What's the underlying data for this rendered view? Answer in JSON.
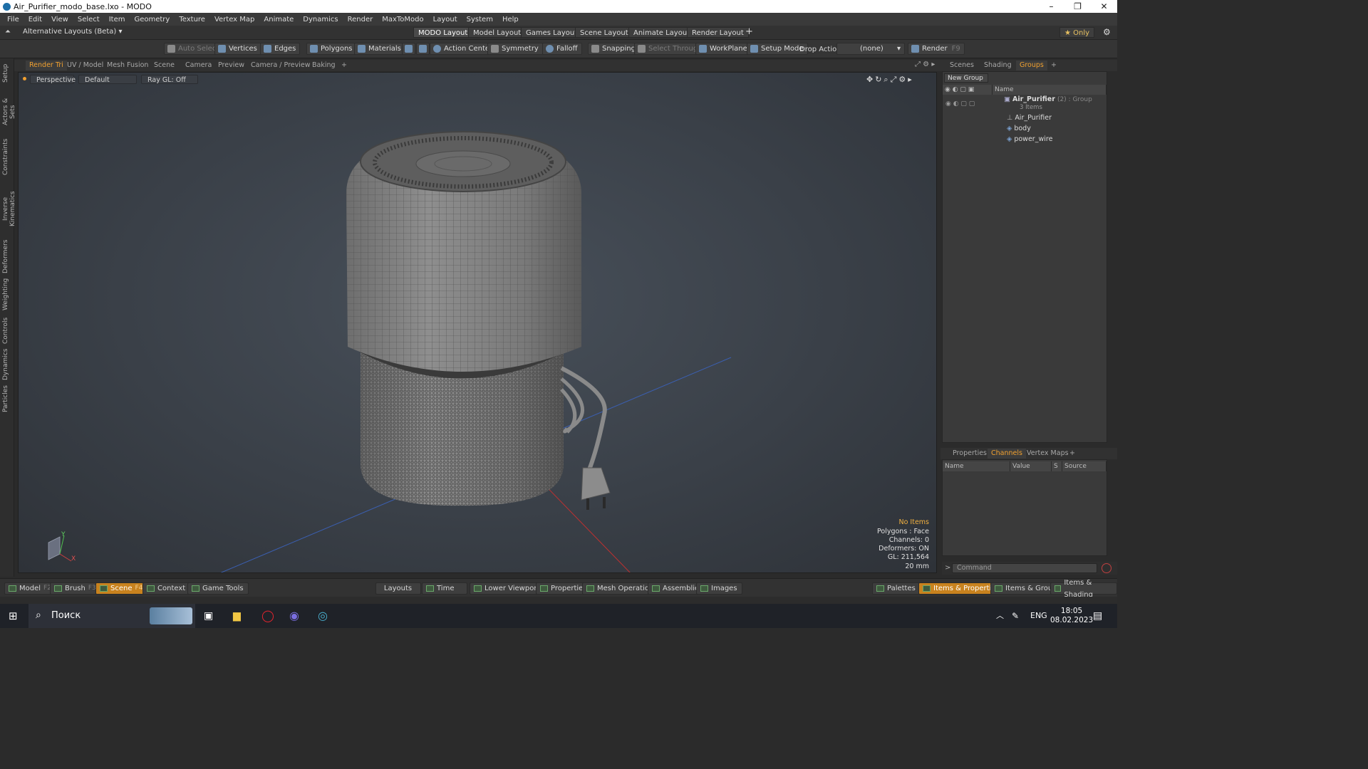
{
  "window": {
    "title": "Air_Purifier_modo_base.lxo - MODO",
    "controls": [
      "–",
      "❐",
      "✕"
    ]
  },
  "menu": [
    "File",
    "Edit",
    "View",
    "Select",
    "Item",
    "Geometry",
    "Texture",
    "Vertex Map",
    "Animate",
    "Dynamics",
    "Render",
    "MaxToModo",
    "Layout",
    "System",
    "Help"
  ],
  "layoutbar": {
    "alt_layouts": "Alternative Layouts (Beta) ▾",
    "tabs": [
      "MODO Layout",
      "Model Layout",
      "Games Layout",
      "Scene Layout",
      "Animate Layout",
      "Render Layout"
    ],
    "add": "+",
    "only": "★  Only"
  },
  "toolbar": {
    "auto_select": "Auto Select",
    "vertices": "Vertices",
    "edges": "Edges",
    "polygons": "Polygons",
    "materials": "Materials",
    "action_center": "Action Center",
    "symmetry": "Symmetry",
    "falloff": "Falloff",
    "snapping": "Snapping",
    "select_through": "Select Through",
    "workplane": "WorkPlane",
    "setup_mode": "Setup Mode",
    "drop_action": "Drop Action",
    "drop_value": "(none)",
    "render": "Render",
    "render_key": "F9"
  },
  "left_tabs": [
    "Setup",
    "Actors & Sets",
    "Constraints",
    "Inverse Kinematics",
    "Deformers",
    "Weighting",
    "Controls",
    "Dynamics",
    "Particles"
  ],
  "viewport_tabs": [
    "Render Tri",
    "UV / Model",
    "Mesh Fusion",
    "Scene",
    "Camera",
    "Preview",
    "Camera / Preview",
    "Baking",
    "+"
  ],
  "viewport": {
    "view": "Perspective",
    "shading": "Default",
    "raygl": "Ray GL: Off",
    "info": {
      "items": "No Items",
      "polygons": "Polygons : Face",
      "channels": "Channels: 0",
      "deformers": "Deformers: ON",
      "gl": "GL: 211,564",
      "scale": "20 mm"
    },
    "axis_y": "Y",
    "axis_x": "X"
  },
  "right_top_tabs": [
    "Scenes",
    "Shading",
    "Groups",
    "+"
  ],
  "groups": {
    "new_group": "New Group",
    "col_name": "Name",
    "root": "Air_Purifier",
    "root_suffix": "(2) : Group",
    "root_count": "3 Items",
    "children": [
      "Air_Purifier",
      "body",
      "power_wire"
    ]
  },
  "right_bottom_tabs": [
    "Properties",
    "Channels",
    "Vertex Maps",
    "+"
  ],
  "channels": {
    "col_name": "Name",
    "col_value": "Value",
    "col_s": "S",
    "col_source": "Source"
  },
  "command": {
    "prompt": ">",
    "placeholder": "Command"
  },
  "bottom": {
    "model": "Model",
    "model_key": "F2",
    "brush": "Brush",
    "brush_key": "F3",
    "scene": "Scene",
    "scene_key": "F4",
    "context": "Context",
    "game_tools": "Game Tools",
    "layouts": "Layouts",
    "time": "Time",
    "lower_viewports": "Lower Viewports",
    "properties": "Properties",
    "mesh_operations": "Mesh Operations",
    "assemblies": "Assemblies",
    "images": "Images",
    "palettes": "Palettes",
    "items_properties": "Items & Properties",
    "items_groups": "Items & Groups",
    "items_shading": "Items & Shading"
  },
  "taskbar": {
    "search": "Поиск",
    "lang": "ENG",
    "time": "18:05",
    "date": "08.02.2023"
  },
  "colors": {
    "accent": "#f0a030",
    "active_button": "#c8821e"
  }
}
